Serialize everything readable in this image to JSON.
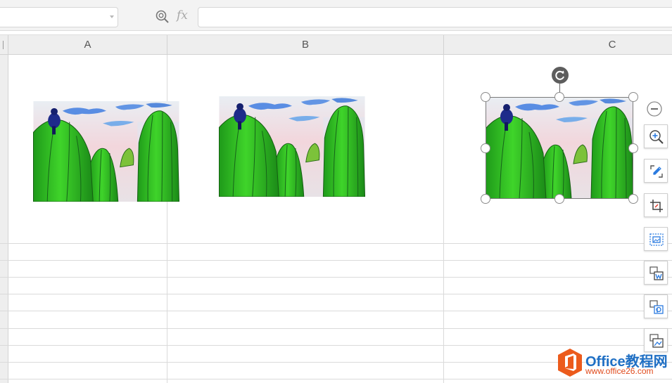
{
  "formula_bar": {
    "name_box_value": "",
    "fx_label": "fx",
    "formula_value": ""
  },
  "columns": [
    {
      "label": "A"
    },
    {
      "label": "B"
    },
    {
      "label": "C"
    }
  ],
  "pictures": [
    {
      "name": "cactus-picture-1",
      "selected": false
    },
    {
      "name": "cactus-picture-2",
      "selected": false
    },
    {
      "name": "cactus-picture-3",
      "selected": true
    }
  ],
  "side_toolbar": {
    "items": [
      {
        "icon": "collapse-icon"
      },
      {
        "icon": "zoom-in-icon"
      },
      {
        "icon": "smart-crop-icon"
      },
      {
        "icon": "crop-icon"
      },
      {
        "icon": "image-frame-icon"
      },
      {
        "icon": "picture-to-word-icon"
      },
      {
        "icon": "picture-to-pdf-icon"
      },
      {
        "icon": "batch-picture-icon"
      }
    ]
  },
  "watermark": {
    "brand": "Office教程网",
    "url": "www.office26.com"
  },
  "colors": {
    "header_bg": "#eeeeee",
    "grid_line": "#dadada",
    "brand_blue": "#1f6fc4",
    "brand_orange": "#e04a1b"
  }
}
